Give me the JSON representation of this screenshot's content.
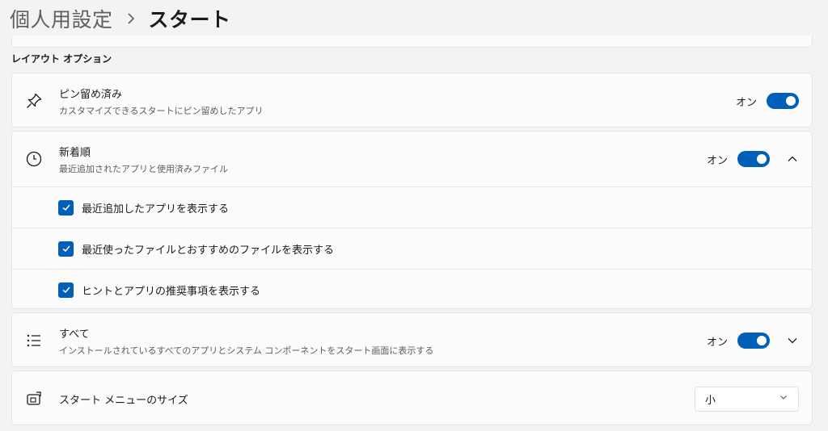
{
  "breadcrumb": {
    "parent": "個人用設定",
    "current": "スタート"
  },
  "section_title": "レイアウト オプション",
  "pinned": {
    "title": "ピン留め済み",
    "description": "カスタマイズできるスタートにピン留めしたアプリ",
    "state": "オン",
    "icon": "pin-icon"
  },
  "recent": {
    "title": "新着順",
    "description": "最近追加されたアプリと使用済みファイル",
    "state": "オン",
    "icon": "clock-icon",
    "options": [
      {
        "label": "最近追加したアプリを表示する",
        "checked": true
      },
      {
        "label": "最近使ったファイルとおすすめのファイルを表示する",
        "checked": true
      },
      {
        "label": "ヒントとアプリの推奨事項を表示する",
        "checked": true
      }
    ]
  },
  "all": {
    "title": "すべて",
    "description": "インストールされているすべてのアプリとシステム コンポーネントをスタート画面に表示する",
    "state": "オン",
    "icon": "list-icon"
  },
  "menu_size": {
    "title": "スタート メニューのサイズ",
    "selected": "小",
    "icon": "start-menu-resize-icon"
  },
  "colors": {
    "accent": "#005fb8",
    "background": "#f3f3f3",
    "card": "#fbfbfb"
  }
}
